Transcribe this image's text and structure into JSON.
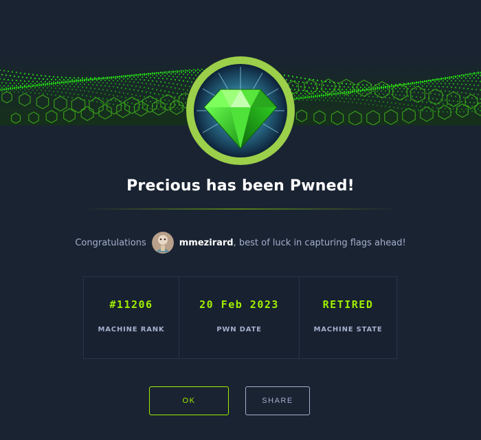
{
  "machine": {
    "title": "Precious has been Pwned!"
  },
  "congrats": {
    "prefix": "Congratulations",
    "username": "mmezirard",
    "suffix": ", best of luck in capturing flags ahead!"
  },
  "stats": [
    {
      "value": "#11206",
      "label": "MACHINE RANK"
    },
    {
      "value": "20 Feb 2023",
      "label": "PWN DATE"
    },
    {
      "value": "RETIRED",
      "label": "MACHINE STATE"
    }
  ],
  "buttons": {
    "ok_label": "OK",
    "share_label": "SHARE"
  },
  "colors": {
    "background": "#1a2332",
    "accent": "#9fef00",
    "muted": "#a4b1cd",
    "border": "#2a3447"
  },
  "icons": {
    "badge": "green-gem-icon",
    "banner": "hex-wave-banner"
  }
}
